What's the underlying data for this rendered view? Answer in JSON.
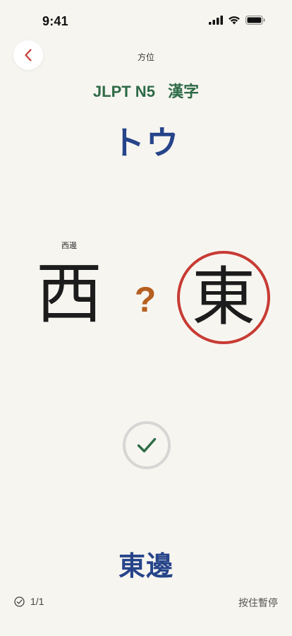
{
  "status_bar": {
    "time": "9:41"
  },
  "header": {
    "back_icon": "chevron-left-icon",
    "category": "方位",
    "level": "JLPT N5",
    "script_type": "漢字"
  },
  "card": {
    "reading": "トウ",
    "hint_label": "西邊",
    "left_kanji": "西",
    "question_mark": "?",
    "answer_kanji": "東",
    "answer_word": "東邊"
  },
  "footer": {
    "progress": "1/1",
    "pause_hint": "按住暫停"
  },
  "colors": {
    "background": "#F7F5F0",
    "level_green": "#2E6B47",
    "reading_blue": "#26448A",
    "question_orange": "#B55F20",
    "circle_red": "#C73B34",
    "check_green": "#2E6B47"
  }
}
